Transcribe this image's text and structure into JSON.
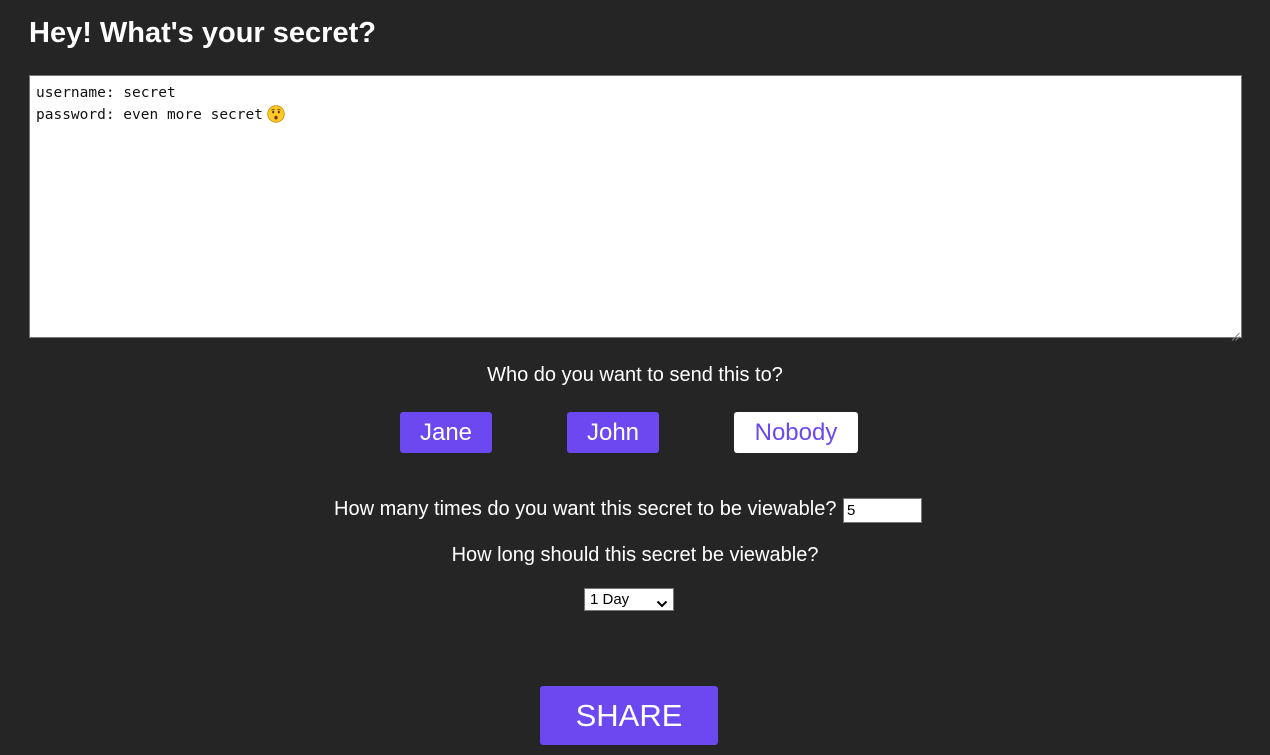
{
  "header": {
    "title": "Hey! What's your secret?"
  },
  "secret": {
    "line1": "username: secret",
    "line2": "password: even more secret",
    "emoji_icon": "hushed-face-emoji"
  },
  "recipients": {
    "question": "Who do you want to send this to?",
    "options": [
      {
        "label": "Jane",
        "selected": true
      },
      {
        "label": "John",
        "selected": true
      },
      {
        "label": "Nobody",
        "selected": false
      }
    ]
  },
  "views": {
    "question": "How many times do you want this secret to be viewable?",
    "value": "5"
  },
  "duration": {
    "question": "How long should this secret be viewable?",
    "selected": "1 Day"
  },
  "actions": {
    "share_label": "SHARE"
  },
  "colors": {
    "background": "#252525",
    "accent": "#6b48f0",
    "text": "#ffffff"
  }
}
